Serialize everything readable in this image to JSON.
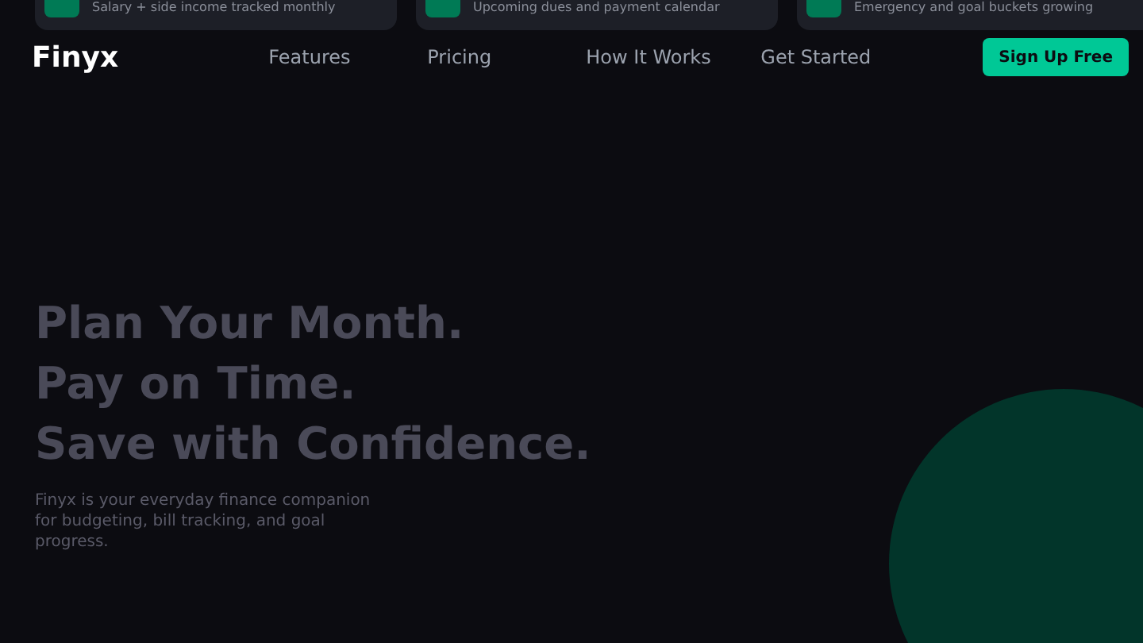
{
  "cards": [
    {
      "text": "Salary + side income tracked monthly"
    },
    {
      "text": "Upcoming dues and payment calendar"
    },
    {
      "text": "Emergency and goal buckets growing"
    }
  ],
  "nav": {
    "logo": "Finyx",
    "links": [
      "Features",
      "Pricing",
      "How It Works",
      "Get Started"
    ],
    "cta": "Sign Up Free"
  },
  "hero": {
    "headline": [
      "Plan Your Month.",
      "Pay on Time.",
      "Save with Confidence."
    ],
    "subtitle": "Finyx is your everyday finance companion for budgeting, bill tracking, and goal progress."
  }
}
